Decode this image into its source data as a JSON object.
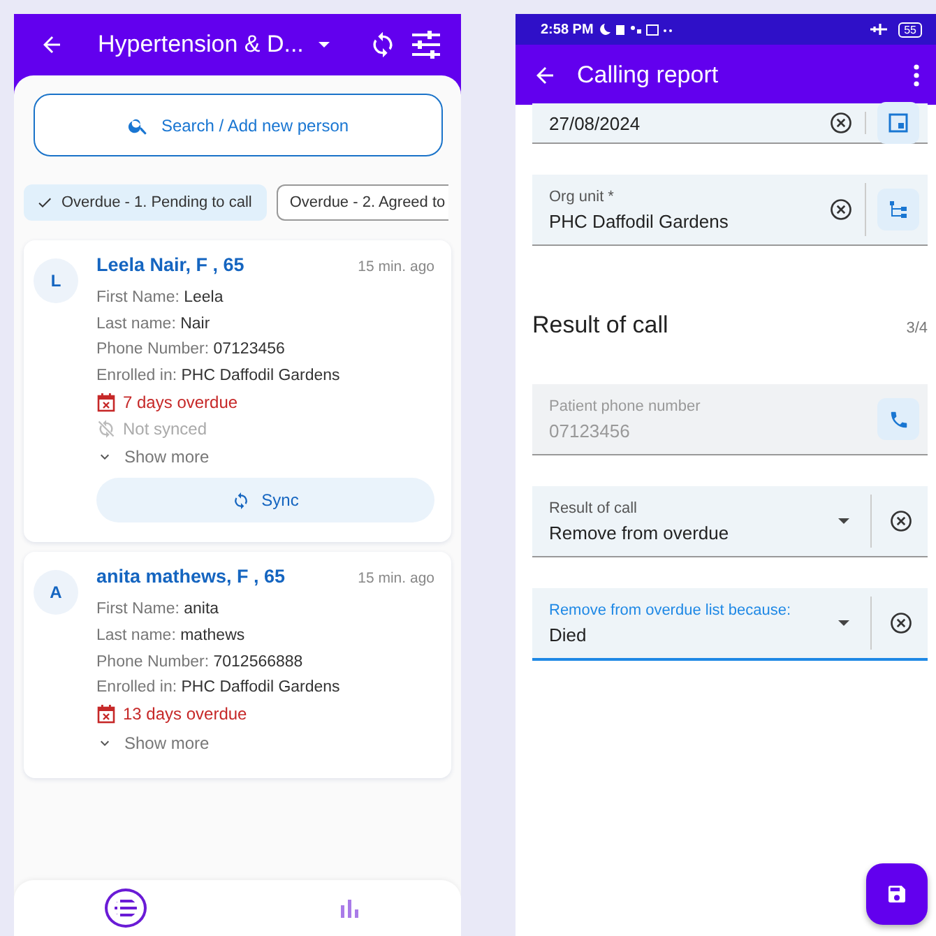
{
  "left": {
    "appbar": {
      "title": "Hypertension & D..."
    },
    "search": {
      "label": "Search / Add new person"
    },
    "chips": [
      {
        "label": "Overdue - 1. Pending to call",
        "selected": true
      },
      {
        "label": "Overdue - 2. Agreed to",
        "selected": false
      }
    ],
    "persons": [
      {
        "initial": "L",
        "name": "Leela Nair, F , 65",
        "time": "15 min. ago",
        "fields": [
          {
            "label": "First Name:",
            "value": "Leela"
          },
          {
            "label": "Last name:",
            "value": "Nair"
          },
          {
            "label": "Phone Number:",
            "value": "07123456"
          },
          {
            "label": "Enrolled in:",
            "value": "PHC Daffodil Gardens"
          }
        ],
        "overdue": "7 days overdue",
        "sync_status": "Not synced",
        "show_more": "Show more",
        "sync_button": "Sync"
      },
      {
        "initial": "A",
        "name": "anita mathews, F , 65",
        "time": "15 min. ago",
        "fields": [
          {
            "label": "First Name:",
            "value": "anita"
          },
          {
            "label": "Last name:",
            "value": "mathews"
          },
          {
            "label": "Phone Number:",
            "value": "7012566888"
          },
          {
            "label": "Enrolled in:",
            "value": "PHC Daffodil Gardens"
          }
        ],
        "overdue": "13 days overdue",
        "show_more": "Show more"
      }
    ],
    "bottom_nav": [
      {
        "kind": "list",
        "selected": true
      },
      {
        "kind": "chart",
        "selected": false
      }
    ]
  },
  "right": {
    "status_bar": {
      "time": "2:58 PM",
      "battery": "55"
    },
    "appbar": {
      "title": "Calling report"
    },
    "top_fields": [
      {
        "kind": "date",
        "value": "27/08/2024"
      },
      {
        "kind": "orgunit",
        "label": "Org unit *",
        "value": "PHC Daffodil Gardens"
      }
    ],
    "section": {
      "title": "Result of call",
      "counter": "3/4"
    },
    "fields": [
      {
        "kind": "phone",
        "label": "Patient phone number",
        "value": "07123456",
        "disabled": true,
        "focused": false
      },
      {
        "kind": "dropdown",
        "label": "Result of call",
        "value": "Remove from overdue",
        "disabled": false,
        "focused": false
      },
      {
        "kind": "dropdown",
        "label": "Remove from overdue list because:",
        "value": "Died",
        "disabled": false,
        "focused": true
      }
    ]
  }
}
